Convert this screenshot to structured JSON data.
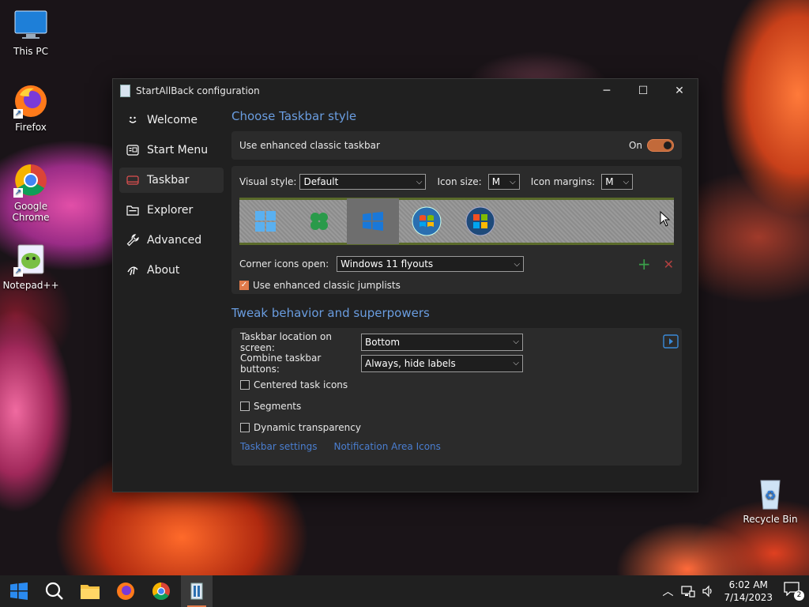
{
  "desktop": {
    "icons": [
      {
        "label": "This PC"
      },
      {
        "label": "Firefox"
      },
      {
        "label": "Google Chrome"
      },
      {
        "label": "Notepad++"
      },
      {
        "label": "Recycle Bin"
      }
    ]
  },
  "window": {
    "title": "StartAllBack configuration",
    "controls": {
      "minimize": "─",
      "maximize": "☐",
      "close": "✕"
    }
  },
  "sidebar": {
    "items": [
      {
        "label": "Welcome",
        "icon": "smile-icon"
      },
      {
        "label": "Start Menu",
        "icon": "start-menu-icon"
      },
      {
        "label": "Taskbar",
        "icon": "taskbar-icon"
      },
      {
        "label": "Explorer",
        "icon": "folder-icon"
      },
      {
        "label": "Advanced",
        "icon": "wrench-icon"
      },
      {
        "label": "About",
        "icon": "about-icon"
      }
    ],
    "active": "Taskbar"
  },
  "taskbar_style": {
    "heading": "Choose Taskbar style",
    "enhanced_label": "Use enhanced classic taskbar",
    "enhanced_state": "On",
    "visual_style_label": "Visual style:",
    "visual_style_value": "Default",
    "icon_size_label": "Icon size:",
    "icon_size_value": "M",
    "icon_margins_label": "Icon margins:",
    "icon_margins_value": "M",
    "style_options": [
      "windows-11-icon",
      "clover-icon",
      "windows-10-icon",
      "windows-7-orb-icon",
      "windows-vista-orb-icon"
    ],
    "corner_label": "Corner icons open:",
    "corner_value": "Windows 11 flyouts",
    "jumplists_label": "Use enhanced classic jumplists",
    "jumplists_checked": true
  },
  "tweaks": {
    "heading": "Tweak behavior and superpowers",
    "location_label": "Taskbar location on screen:",
    "location_value": "Bottom",
    "combine_label": "Combine taskbar buttons:",
    "combine_value": "Always, hide labels",
    "checkboxes": [
      {
        "label": "Centered task icons",
        "checked": false
      },
      {
        "label": "Segments",
        "checked": false
      },
      {
        "label": "Dynamic transparency",
        "checked": false
      }
    ],
    "links": [
      "Taskbar settings",
      "Notification Area Icons"
    ]
  },
  "taskbar": {
    "time": "6:02 AM",
    "date": "7/14/2023",
    "notification_count": "2",
    "accent": "#e07a4a"
  }
}
